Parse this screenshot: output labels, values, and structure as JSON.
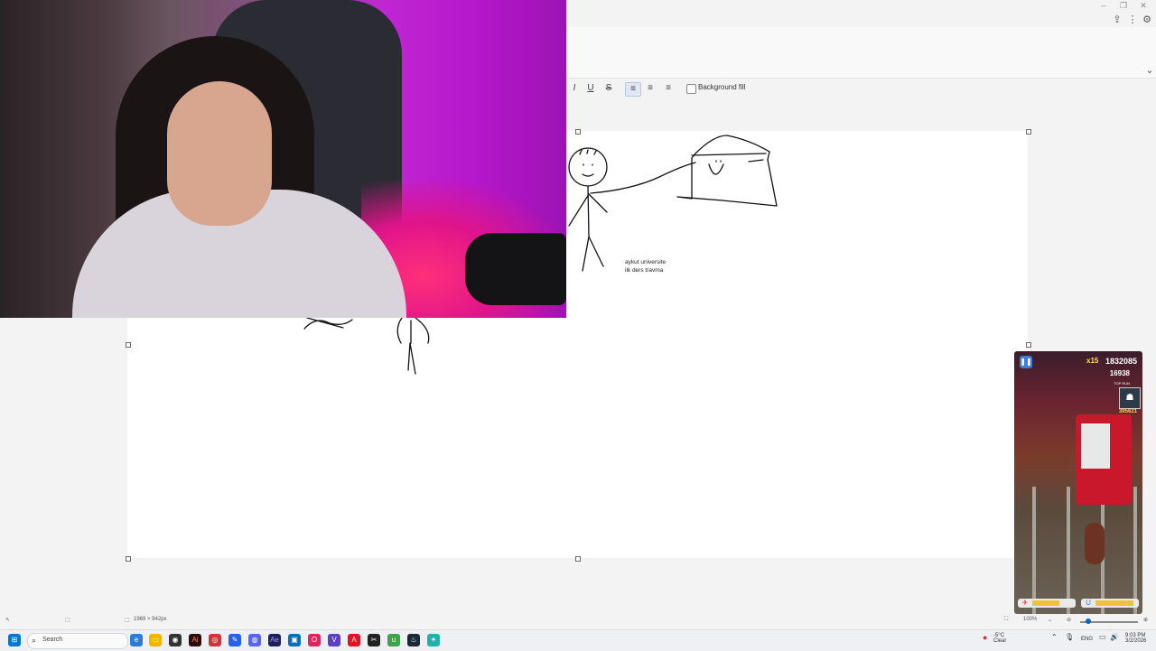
{
  "ribbon": {
    "text_tools": {
      "italic": "I",
      "underline": "U",
      "strike": "S",
      "background_fill_label": "Background fill"
    }
  },
  "canvas": {
    "note_line1": "aykut universite",
    "note_line2": "ilk ders travma"
  },
  "game": {
    "multiplier": "x15",
    "score": "1832085",
    "coins": "16938",
    "top_run_label": "TOP RUN",
    "high_score": "395621"
  },
  "statusbar": {
    "dimensions": "1969 × 942px",
    "zoom": "100%"
  },
  "taskbar": {
    "search_placeholder": "Search",
    "weather_temp": "-5°C",
    "weather_cond": "Clear",
    "language": "ENG",
    "time": "9:03 PM",
    "date": "3/2/2026"
  },
  "colors": {
    "accent": "#0067c0",
    "canvas_bg": "#ffffff",
    "webcam_light": "#c026d3"
  }
}
